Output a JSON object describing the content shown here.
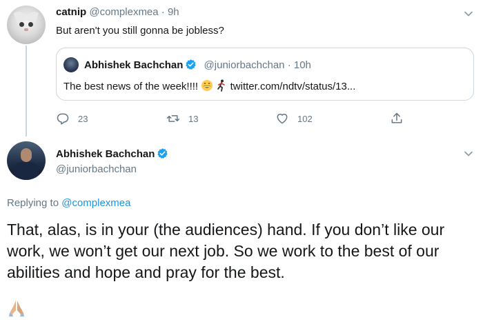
{
  "tweet1": {
    "name": "catnip",
    "handle": "@complexmea",
    "separator": "·",
    "time": "9h",
    "text": "But aren't you still gonna be jobless?",
    "quote": {
      "name": "Abhishek Bachchan",
      "handle": "@juniorbachchan",
      "separator": "·",
      "time": "10h",
      "text": "The best news of the week!!!!",
      "link": "twitter.com/ndtv/status/13..."
    },
    "actions": {
      "replies": "23",
      "retweets": "13",
      "likes": "102"
    }
  },
  "tweet2": {
    "name": "Abhishek Bachchan",
    "handle": "@juniorbachchan",
    "replying_prefix": "Replying to",
    "replying_to": "@complexmea",
    "text": "That, alas, is in your (the audiences) hand. If you don’t like our work, we won’t get our next job. So we work to the best of our abilities and hope and pray for the best."
  },
  "colors": {
    "link": "#1b95e0",
    "verified": "#1da1f2",
    "muted": "#657786",
    "border": "#ccd6dd"
  },
  "icons": [
    "reply-icon",
    "retweet-icon",
    "like-icon",
    "share-icon",
    "chevron-down-icon",
    "verified-badge-icon",
    "grinning-emoji-icon",
    "running-person-emoji-icon",
    "praying-hands-emoji-icon"
  ]
}
